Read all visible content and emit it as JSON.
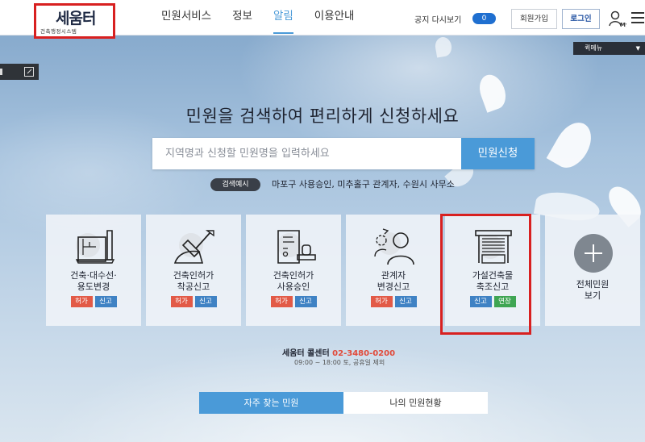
{
  "header": {
    "logo_text": "세움터",
    "logo_subtitle": "건축행정시스템",
    "nav": [
      "민원서비스",
      "정보",
      "알림",
      "이용안내"
    ],
    "active_nav": "알림",
    "notice_label": "공지 다시보기",
    "notice_count": "0",
    "signup_label": "회원가입",
    "login_label": "로그인",
    "my_label": "My"
  },
  "quick_menu": {
    "label": "퀵메뉴"
  },
  "hero": {
    "title": "민원을 검색하여 편리하게 신청하세요",
    "search_placeholder": "지역명과 신청할 민원명을 입력하세요",
    "search_button": "민원신청",
    "example_badge": "검색예시",
    "example_text": "마포구 사용승인, 미추홀구 관계자, 수원시 사무소"
  },
  "cards": [
    {
      "line1": "건축·대수선·",
      "line2": "용도변경",
      "tags": [
        "허가",
        "신고"
      ],
      "icon": "blueprint-icon"
    },
    {
      "line1": "건축인허가",
      "line2": "착공신고",
      "tags": [
        "허가",
        "신고"
      ],
      "icon": "shovel-icon"
    },
    {
      "line1": "건축인허가",
      "line2": "사용승인",
      "tags": [
        "허가",
        "신고"
      ],
      "icon": "stamp-document-icon"
    },
    {
      "line1": "관계자",
      "line2": "변경신고",
      "tags": [
        "허가",
        "신고"
      ],
      "icon": "person-change-icon"
    },
    {
      "line1": "가설건축물",
      "line2": "축조신고",
      "tags": [
        "신고",
        "연장"
      ],
      "icon": "shutter-building-icon"
    },
    {
      "line1": "전체민원",
      "line2": "보기",
      "icon": "plus-icon"
    }
  ],
  "call_center": {
    "label": "세움터 콜센터",
    "phone": "02-3480-0200",
    "hours": "09:00 ~ 18:00 토, 공휴일 제외"
  },
  "tabs": [
    "자주 찾는 민원",
    "나의 민원현황"
  ]
}
